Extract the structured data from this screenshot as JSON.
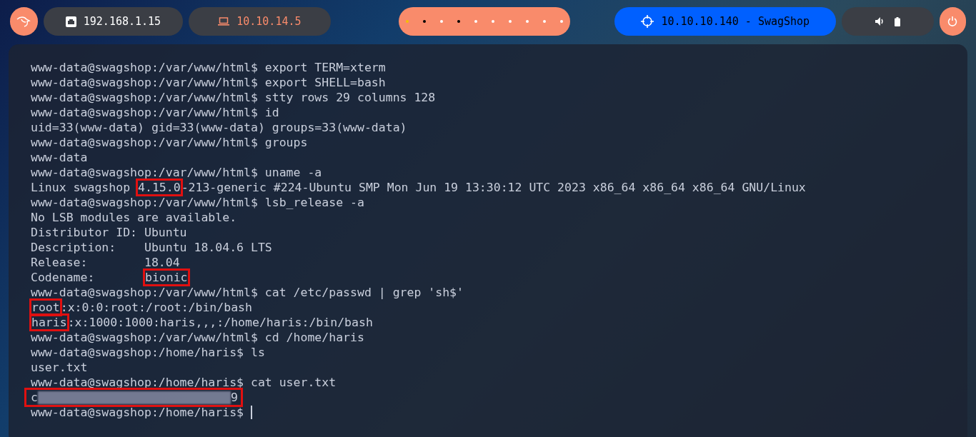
{
  "topbar": {
    "local_ip": "192.168.1.15",
    "vpn_ip": "10.10.14.5",
    "workspaces": [
      {
        "color": "#f5c000"
      },
      {
        "color": "#000000"
      },
      {
        "color": "#ffffff"
      },
      {
        "color": "#000000"
      },
      {
        "color": "#ffffff"
      },
      {
        "color": "#ffffff"
      },
      {
        "color": "#ffffff"
      },
      {
        "color": "#ffffff"
      },
      {
        "color": "#ffffff"
      },
      {
        "color": "#ffffff"
      }
    ],
    "target": "10.10.10.140 - SwagShop"
  },
  "terminal": {
    "lines": [
      {
        "segments": [
          {
            "kind": "text",
            "text": "www-data@swagshop:/var/www/html$ export TERM=xterm"
          }
        ]
      },
      {
        "segments": [
          {
            "kind": "text",
            "text": "www-data@swagshop:/var/www/html$ export SHELL=bash"
          }
        ]
      },
      {
        "segments": [
          {
            "kind": "text",
            "text": "www-data@swagshop:/var/www/html$ stty rows 29 columns 128"
          }
        ]
      },
      {
        "segments": [
          {
            "kind": "text",
            "text": "www-data@swagshop:/var/www/html$ id"
          }
        ]
      },
      {
        "segments": [
          {
            "kind": "text",
            "text": "uid=33(www-data) gid=33(www-data) groups=33(www-data)"
          }
        ]
      },
      {
        "segments": [
          {
            "kind": "text",
            "text": "www-data@swagshop:/var/www/html$ groups"
          }
        ]
      },
      {
        "segments": [
          {
            "kind": "text",
            "text": "www-data"
          }
        ]
      },
      {
        "segments": [
          {
            "kind": "text",
            "text": "www-data@swagshop:/var/www/html$ uname -a"
          }
        ]
      },
      {
        "segments": [
          {
            "kind": "text",
            "text": "Linux swagshop "
          },
          {
            "kind": "highlight",
            "text": "4.15.0"
          },
          {
            "kind": "text",
            "text": "-213-generic #224-Ubuntu SMP Mon Jun 19 13:30:12 UTC 2023 x86_64 x86_64 x86_64 GNU/Linux"
          }
        ]
      },
      {
        "segments": [
          {
            "kind": "text",
            "text": "www-data@swagshop:/var/www/html$ lsb_release -a"
          }
        ]
      },
      {
        "segments": [
          {
            "kind": "text",
            "text": "No LSB modules are available."
          }
        ]
      },
      {
        "segments": [
          {
            "kind": "text",
            "text": "Distributor ID: Ubuntu"
          }
        ]
      },
      {
        "segments": [
          {
            "kind": "text",
            "text": "Description:    Ubuntu 18.04.6 LTS"
          }
        ]
      },
      {
        "segments": [
          {
            "kind": "text",
            "text": "Release:        18.04"
          }
        ]
      },
      {
        "segments": [
          {
            "kind": "text",
            "text": "Codename:       "
          },
          {
            "kind": "highlight",
            "text": "bionic"
          }
        ]
      },
      {
        "segments": [
          {
            "kind": "text",
            "text": "www-data@swagshop:/var/www/html$ cat /etc/passwd | grep 'sh$'"
          }
        ]
      },
      {
        "segments": [
          {
            "kind": "highlight",
            "text": "root"
          },
          {
            "kind": "text",
            "text": ":x:0:0:root:/root:/bin/bash"
          }
        ]
      },
      {
        "segments": [
          {
            "kind": "highlight",
            "text": "haris"
          },
          {
            "kind": "text",
            "text": ":x:1000:1000:haris,,,:/home/haris:/bin/bash"
          }
        ]
      },
      {
        "segments": [
          {
            "kind": "text",
            "text": "www-data@swagshop:/var/www/html$ cd /home/haris"
          }
        ]
      },
      {
        "segments": [
          {
            "kind": "text",
            "text": "www-data@swagshop:/home/haris$ ls"
          }
        ]
      },
      {
        "segments": [
          {
            "kind": "text",
            "text": "user.txt"
          }
        ]
      },
      {
        "segments": [
          {
            "kind": "text",
            "text": "www-data@swagshop:/home/haris$ cat user.txt"
          }
        ]
      },
      {
        "boxed": true,
        "segments": [
          {
            "kind": "text",
            "text": "c"
          },
          {
            "kind": "redacted"
          },
          {
            "kind": "text",
            "text": "9"
          }
        ]
      },
      {
        "cursor": true,
        "segments": [
          {
            "kind": "text",
            "text": "www-data@swagshop:/home/haris$ "
          }
        ]
      }
    ]
  }
}
